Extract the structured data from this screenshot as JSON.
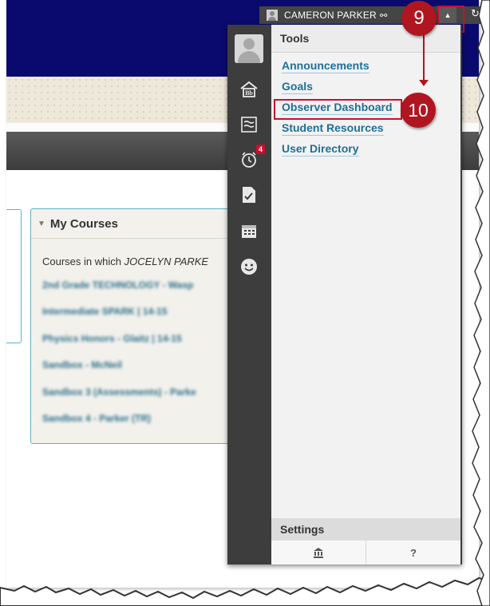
{
  "header": {
    "user_name": "CAMERON PARKER",
    "link_icon": "link-icon",
    "toggle_icon": "caret-up-icon",
    "refresh_icon": "refresh-icon"
  },
  "callouts": {
    "step_9": "9",
    "step_10": "10",
    "color": "#b0161f"
  },
  "my_courses": {
    "title": "My Courses",
    "intro_prefix": "Courses in which ",
    "intro_name": "JOCELYN PARKE",
    "courses": [
      "2nd Grade TECHNOLOGY - Wasp",
      "Intermediate SPARK | 14-15",
      "Physics Honors - Glaitz | 14-15",
      "Sandbox - McNeil",
      "Sandbox 3 (Assessments) - Parke",
      "Sandbox 4 - Parker (TR)"
    ]
  },
  "rail": {
    "icons": [
      "avatar-icon",
      "blackboard-home-icon",
      "stream-icon",
      "alarm-clock-icon",
      "grades-icon",
      "calendar-icon",
      "smiley-icon"
    ],
    "alarm_badge": "4",
    "home_glyph": "Bb"
  },
  "tools": {
    "header": "Tools",
    "links": [
      "Announcements",
      "Goals",
      "Observer Dashboard",
      "Student Resources",
      "User Directory"
    ]
  },
  "settings": {
    "header": "Settings",
    "help": "?",
    "institution_icon": "institution-icon"
  },
  "colors": {
    "nav": "#0a0a6e",
    "link": "#1e6f99",
    "accent": "#c8102e",
    "panel_border": "#5cb3c4"
  }
}
